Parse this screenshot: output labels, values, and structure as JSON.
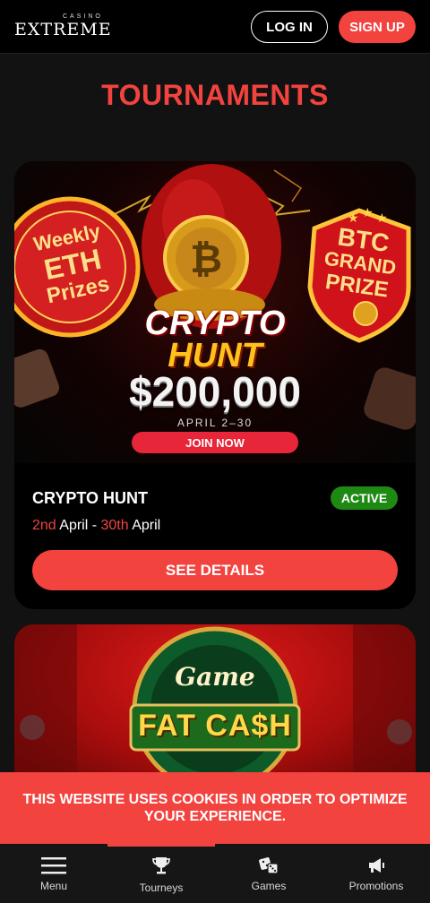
{
  "header": {
    "logo_small": "CASINO",
    "logo_main": "EXTREME",
    "login_label": "LOG IN",
    "signup_label": "SIGN UP"
  },
  "page_title": "TOURNAMENTS",
  "tournaments": [
    {
      "banner": {
        "left_badge": [
          "Weekly",
          "ETH",
          "Prizes"
        ],
        "right_badge": [
          "BTC",
          "GRAND",
          "PRIZE"
        ],
        "headline_1": "CRYPTO",
        "headline_2": "HUNT",
        "amount": "$200,000",
        "dates": "APRIL 2–30",
        "cta": "JOIN NOW"
      },
      "title": "CRYPTO HUNT",
      "status": "ACTIVE",
      "date_start_num": "2nd",
      "date_start_month": "April",
      "date_sep": " - ",
      "date_end_num": "30th",
      "date_end_month": "April",
      "details_label": "SEE DETAILS"
    },
    {
      "banner": {
        "headline_1": "Game",
        "headline_2": "FAT CA$H"
      }
    }
  ],
  "cookie_notice": "THIS WEBSITE USES COOKIES IN ORDER TO OPTIMIZE YOUR EXPERIENCE.",
  "bottom_nav": [
    {
      "label": "Menu",
      "icon": "hamburger-icon"
    },
    {
      "label": "Tourneys",
      "icon": "trophy-icon"
    },
    {
      "label": "Games",
      "icon": "dice-icon"
    },
    {
      "label": "Promotions",
      "icon": "megaphone-icon"
    }
  ],
  "colors": {
    "accent": "#f2433f",
    "active_badge": "#1e8a14",
    "background": "#121212"
  }
}
